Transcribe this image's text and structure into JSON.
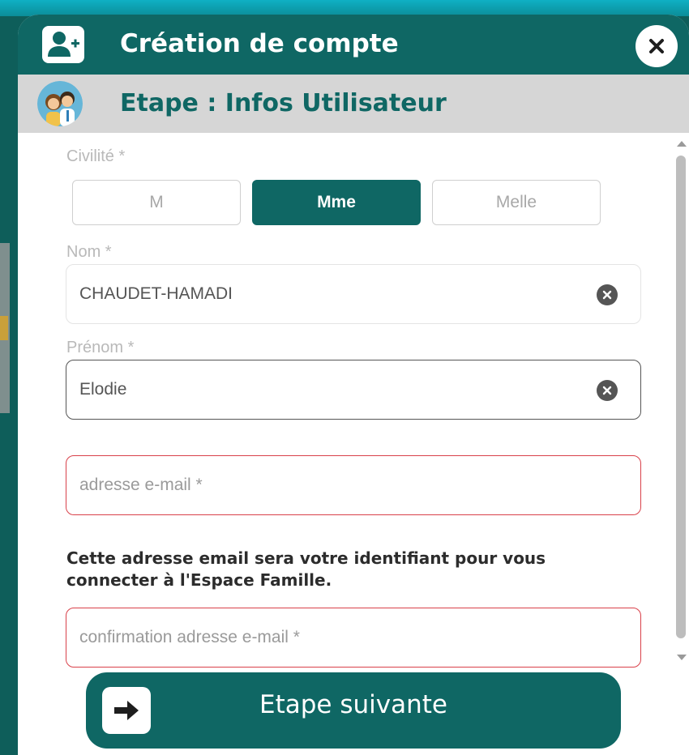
{
  "dialog": {
    "title": "Création de compte",
    "title_icon": "add-user-icon",
    "close_icon": "close-icon"
  },
  "step": {
    "label": "Etape : Infos Utilisateur",
    "avatar_icon": "family-avatar-icon"
  },
  "form": {
    "civility": {
      "label": "Civilité *",
      "options": [
        "M",
        "Mme",
        "Melle"
      ],
      "selected": "Mme"
    },
    "nom": {
      "label": "Nom *",
      "value": "CHAUDET-HAMADI"
    },
    "prenom": {
      "label": "Prénom *",
      "value": "Elodie"
    },
    "email": {
      "placeholder": "adresse e-mail *",
      "value": ""
    },
    "notice": "Cette adresse email sera votre identifiant pour vous connecter à l'Espace Famille.",
    "email_confirm": {
      "placeholder": "confirmation adresse e-mail *",
      "value": ""
    }
  },
  "next_button": {
    "label": "Etape suivante",
    "icon": "arrow-right-icon"
  },
  "colors": {
    "primary": "#0f6764",
    "error": "#d9414a",
    "step_bg": "#d6d6d6"
  }
}
